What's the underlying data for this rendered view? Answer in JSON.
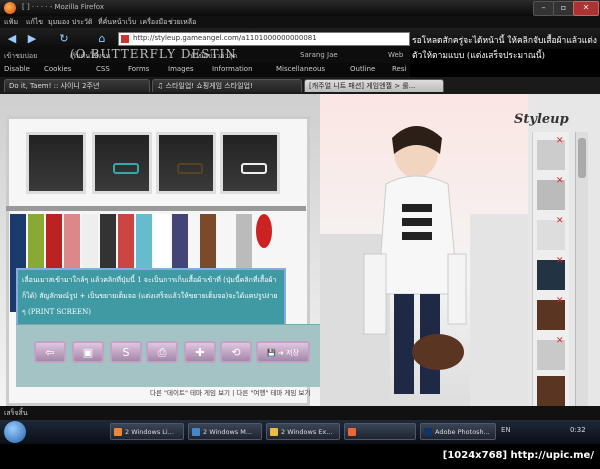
{
  "window": {
    "title": "[ ] · ·  · ·  - Mozilla Firefox",
    "min": "–",
    "max": "▫",
    "close": "✕"
  },
  "menus": [
    "แฟ้ม",
    "แก้ไข",
    "มุมมอง",
    "ประวัติ",
    "ที่คั่นหน้าเว็บ",
    "เครื่องมือ",
    "ช่วยเหลือ"
  ],
  "nav": {
    "back": "◀",
    "forward": "▶",
    "reload": "↻",
    "home": "⌂",
    "url": "http://styleup.gameangel.com/a1101000000000081"
  },
  "bookmarks": [
    "เข้าชมบ่อย",
    "เริ่มต้นใช้งาน",
    "หัวข้อข่าวล่าสุด",
    "Sarang Jae",
    "Web"
  ],
  "devbar": [
    "Disable",
    "Cookies",
    "CSS",
    "Forms",
    "Images",
    "Information",
    "Miscellaneous",
    "Outline",
    "Resi"
  ],
  "overlay_text": "(O.BUTTERFLY DESTIN",
  "banner_text": "รอโหลดสักครู่จะได้หน้านี้ ให้คลิกจับเสื้อผ้าแล้วแต่งตัวให้ตามแบบ (แต่งเสร็จประมาณนี้)",
  "tabs": [
    {
      "label": "Do it, Taem! :: 샤이니 2주년"
    },
    {
      "label": "♫ 스타일업! 쇼핑게임 스타일업!"
    },
    {
      "label": "[캐주얼 니트 패션] 게임엔젤 > 룰..."
    }
  ],
  "game": {
    "logo": "Styleup",
    "panel_text": "เลื่อนเมาสเข้ามาใกล้ๆ แล้วคลิกที่ปุ่มนี้ 1 จะเป็นการเก็บเสื้อผ้าเข้าที่ (ปุ่มนี้คลิกที่เสื้อผ้าก็ได้) สัญลักษณ์รูป + เป็นขยายเต็มจอ (แต่งเสร็จแล้วให้ขยายเต็มจอ)จะได้แคปรูปง่าย ๆ (PRINT SCREEN)",
    "buttons": [
      "⇦",
      "▣",
      "S",
      "⎙",
      "✚",
      "⟲"
    ],
    "save_label": "💾 ➜ 저장",
    "bottom_links": "다른 \"데이트\" 테마 게임 보기 | 다른 \"여행\" 테마 게임 보기",
    "close_x": "✕"
  },
  "status": "เสร็จสิ้น",
  "taskbar": {
    "items": [
      {
        "label": "2 Windows Li..."
      },
      {
        "label": "2 Windows M..."
      },
      {
        "label": "2 Windows Ex..."
      },
      {
        "label": ""
      },
      {
        "label": "Adobe Photosh..."
      }
    ],
    "lang": "EN",
    "clock": "0:32"
  },
  "watermark": "[1024x768] http://upic.me/",
  "colors": {
    "panel": "#3f9aa4",
    "accent": "#c0a3c5",
    "close": "#dd2222"
  }
}
